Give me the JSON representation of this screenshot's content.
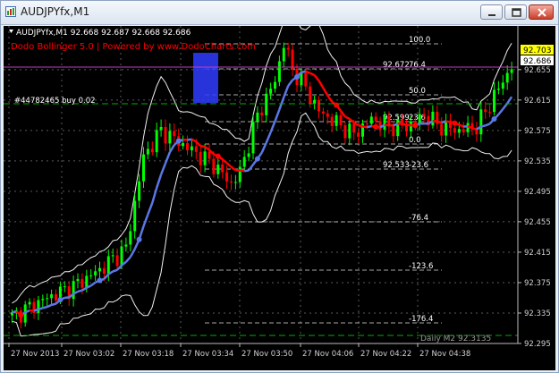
{
  "window": {
    "title": "AUDJPYfx,M1"
  },
  "chart": {
    "info_line": "AUDJPYfx,M1  92.668 92.687 92.668 92.686",
    "indicator_label": "Dodo Bollinger 5.0 | Powered by www.DodoCharts.com",
    "trade_label": "#44782465 buy 0.02",
    "daily_label": "Daily M2 92.3135",
    "price_box_yellow": "92.703",
    "price_box_white": "92.686",
    "fib_levels": [
      "100.0",
      "76.4",
      "50.0",
      "23.6",
      "0.0",
      "-23.6",
      "-76.4",
      "-123.6",
      "-176.4"
    ],
    "fib_prices": [
      "92.672",
      "92.599",
      "92.533"
    ],
    "colors": {
      "background": "#000000",
      "grid": "#5a5a5a",
      "bull_candle": "#00ff00",
      "bear_candle": "#ff0000",
      "mid_band_up": "#5a78e6",
      "mid_band_down": "#ff0000",
      "indicator_text": "#ff0000",
      "trade_line": "#00c000"
    }
  },
  "chart_data": {
    "type": "candlestick",
    "symbol": "AUDJPYfx",
    "timeframe": "M1",
    "ohlc": {
      "open": 92.668,
      "high": 92.687,
      "low": 92.668,
      "close": 92.686
    },
    "y_ticks": [
      "92.703",
      "92.686",
      "92.655",
      "92.615",
      "92.575",
      "92.535",
      "92.495",
      "92.455",
      "92.415",
      "92.375",
      "92.335",
      "92.295"
    ],
    "x_ticks": [
      "27 Nov 2013",
      "27 Nov 03:02",
      "27 Nov 03:18",
      "27 Nov 03:34",
      "27 Nov 03:50",
      "27 Nov 04:06",
      "27 Nov 04:22",
      "27 Nov 04:38"
    ],
    "ylim": [
      92.295,
      92.703
    ],
    "grid": true
  }
}
